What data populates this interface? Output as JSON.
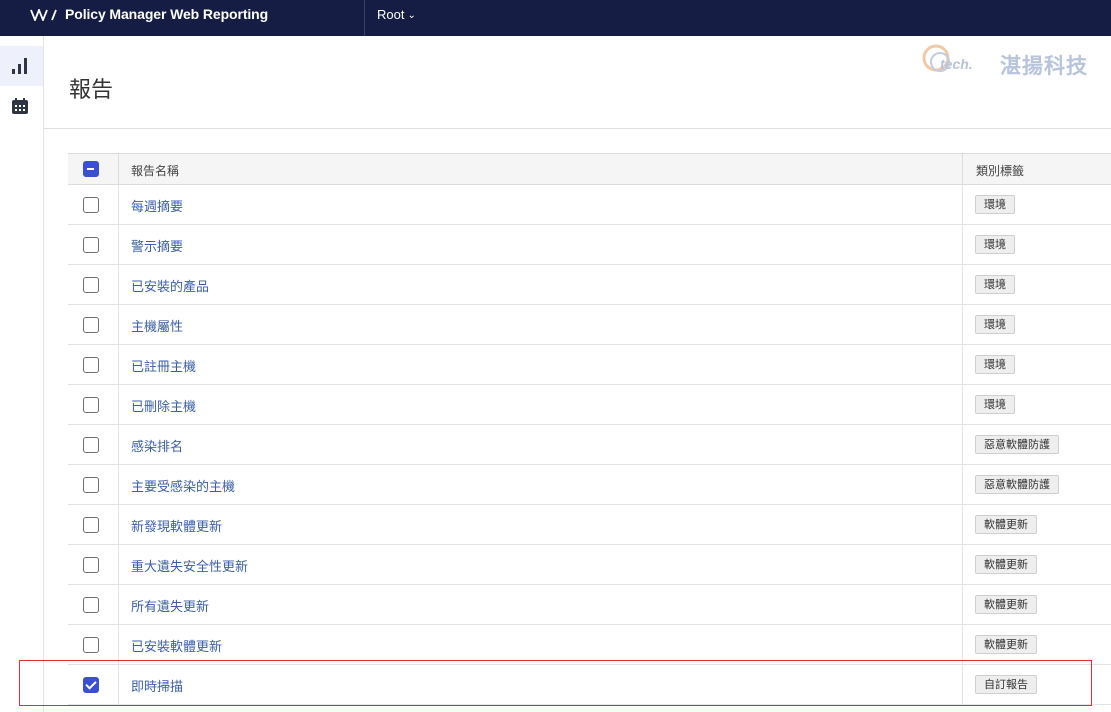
{
  "topbar": {
    "app_title": "Policy Manager Web Reporting",
    "scope_label": "Root",
    "scope_chevron": "⌄"
  },
  "sidebar": {
    "items": [
      {
        "icon": "bar-chart-icon",
        "active": true
      },
      {
        "icon": "calendar-icon",
        "active": false
      }
    ]
  },
  "watermark": {
    "brand_latin": "tech.",
    "brand_cn": "湛揚科技"
  },
  "page": {
    "title": "報告"
  },
  "table": {
    "columns": [
      "報告名稱",
      "類別標籤"
    ],
    "select_all_state": "mixed",
    "rows": [
      {
        "name": "每週摘要",
        "tag": "環境",
        "checked": false
      },
      {
        "name": "警示摘要",
        "tag": "環境",
        "checked": false
      },
      {
        "name": "已安裝的產品",
        "tag": "環境",
        "checked": false
      },
      {
        "name": "主機屬性",
        "tag": "環境",
        "checked": false
      },
      {
        "name": "已註冊主機",
        "tag": "環境",
        "checked": false
      },
      {
        "name": "已刪除主機",
        "tag": "環境",
        "checked": false
      },
      {
        "name": "感染排名",
        "tag": "惡意軟體防護",
        "checked": false
      },
      {
        "name": "主要受感染的主機",
        "tag": "惡意軟體防護",
        "checked": false
      },
      {
        "name": "新發現軟體更新",
        "tag": "軟體更新",
        "checked": false
      },
      {
        "name": "重大遺失安全性更新",
        "tag": "軟體更新",
        "checked": false
      },
      {
        "name": "所有遺失更新",
        "tag": "軟體更新",
        "checked": false
      },
      {
        "name": "已安裝軟體更新",
        "tag": "軟體更新",
        "checked": false
      },
      {
        "name": "即時掃描",
        "tag": "自訂報告",
        "checked": true
      }
    ]
  },
  "colors": {
    "topbar_bg": "#161d45",
    "link": "#3a5fa8",
    "checkbox_accent": "#3a4fd4",
    "highlight_border": "#d9303a"
  }
}
